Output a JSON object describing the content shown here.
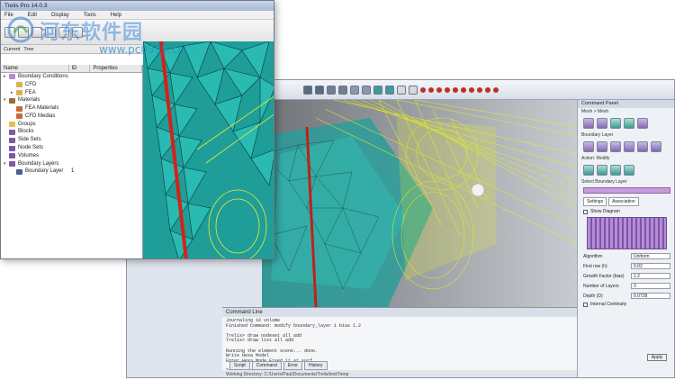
{
  "fg_window": {
    "title": "Trelis Pro 14.0.3",
    "menu": [
      "File",
      "Edit",
      "Display",
      "Tools",
      "Help"
    ],
    "tabs": [
      "Current",
      "Tree"
    ],
    "tree_columns": [
      "Name",
      "ID",
      "Properties"
    ],
    "tree_items": [
      {
        "label": "Boundary Conditions",
        "level": 0,
        "toggle": "▸",
        "icon": "#b48ad2"
      },
      {
        "label": "CFD",
        "level": 1,
        "toggle": "",
        "icon": "#d9b050"
      },
      {
        "label": "FEA",
        "level": 1,
        "toggle": "▸",
        "icon": "#d9b050"
      },
      {
        "label": "Materials",
        "level": 0,
        "toggle": "▾",
        "icon": "#9a6a3a"
      },
      {
        "label": "FEA Materials",
        "level": 1,
        "toggle": "",
        "icon": "#c46a3a"
      },
      {
        "label": "CFD Medias",
        "level": 1,
        "toggle": "",
        "icon": "#c46a3a"
      },
      {
        "label": "Groups",
        "level": 0,
        "toggle": "",
        "icon": "#e2c14e"
      },
      {
        "label": "Blocks",
        "level": 0,
        "toggle": "",
        "icon": "#7c5aa6"
      },
      {
        "label": "Side Sets",
        "level": 0,
        "toggle": "",
        "icon": "#7c5aa6"
      },
      {
        "label": "Node Sets",
        "level": 0,
        "toggle": "",
        "icon": "#7c5aa6"
      },
      {
        "label": "Volumes",
        "level": 0,
        "toggle": "",
        "icon": "#7c5aa6"
      },
      {
        "label": "Boundary Layers",
        "level": 0,
        "toggle": "▾",
        "icon": "#7c5aa6"
      },
      {
        "label": "Boundary Layer",
        "level": 1,
        "toggle": "",
        "icon": "#4a5a9a",
        "id": "1"
      }
    ]
  },
  "bg_window": {
    "command_panel": {
      "title": "Command Panel",
      "breadcrumb": "Mesh > Mesh",
      "section": "Boundary Layer",
      "action": "Action: Modify",
      "select_label": "Select Boundary Layer",
      "tabs": [
        "Settings",
        "Association"
      ],
      "show_diagram": "Show Diagram",
      "algorithm_label": "Algorithm",
      "algorithm_value": "Uniform",
      "first_row_label": "First row (h)",
      "first_row_value": "0.02",
      "growth_label": "Growth Factor (bias)",
      "growth_value": "1.2",
      "layers_label": "Number of Layers",
      "layers_value": "3",
      "depth_label": "Depth (D)",
      "depth_value": "0.0728",
      "internal_continuity": "Internal Continuity",
      "apply": "Apply"
    },
    "command_line": {
      "title": "Command Line",
      "lines": [
        "Journaling 16 volume",
        "Finished Command: modify boundary_layer 1 bias 1.2",
        "",
        "Trelis> draw nodeset all add",
        "Trelis> draw list all add",
        "",
        "Running the element scene... done.",
        "Write Hexa Model",
        "Enter Hexa Mode  Fixed 11 at surf",
        "",
        "Trelis> draw nodeset all add",
        "Trelis> draw list all add"
      ],
      "tabs": [
        "Script",
        "Command",
        "Error",
        "History"
      ],
      "status": "Working Directory: C:/Users/Paul/Documents/Trelis/test/Temp"
    }
  },
  "watermark": {
    "cn_text": "河东软件园",
    "url": "www.pc0359.cn"
  }
}
